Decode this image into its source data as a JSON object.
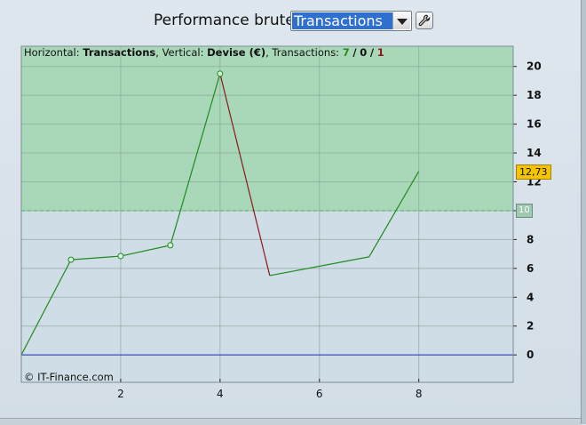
{
  "toolbar": {
    "label": "Performance brute",
    "selected_mode": "Transactions",
    "settings_icon": "wrench-icon"
  },
  "info": {
    "horizontal_label": "Horizontal:",
    "horizontal_value": "Transactions",
    "vertical_label": "Vertical:",
    "vertical_value": "Devise (€)",
    "transactions_label": "Transactions:",
    "wins": "7",
    "neutral": "0",
    "losses": "1",
    "sep1": ",",
    "sep2": ",",
    "slash": "/"
  },
  "copyright": "© IT-Finance.com",
  "badges": {
    "last_value": "12,73",
    "threshold": "10"
  },
  "colors": {
    "profit_zone": "#a9d8b8",
    "loss_zone": "#cfdde6",
    "up_line": "#1f8a1f",
    "down_line": "#8a1a1a",
    "zero_line": "#2233bb",
    "badge_last": "#f5c400"
  },
  "chart_data": {
    "type": "line",
    "x": [
      0,
      1,
      2,
      3,
      4,
      5,
      7,
      8
    ],
    "y": [
      0,
      6.6,
      6.85,
      7.6,
      19.5,
      5.5,
      6.8,
      12.73
    ],
    "markers_at_x": [
      1,
      2,
      3,
      4
    ],
    "x_ticks": [
      "2",
      "4",
      "6",
      "8"
    ],
    "x_tick_values": [
      2,
      4,
      6,
      8
    ],
    "y_ticks": [
      "0",
      "2",
      "4",
      "6",
      "8",
      "10",
      "12",
      "14",
      "16",
      "18",
      "20"
    ],
    "y_tick_values": [
      0,
      2,
      4,
      6,
      8,
      10,
      12,
      14,
      16,
      18,
      20
    ],
    "xlim": [
      0,
      9.9
    ],
    "ylim": [
      -1.9,
      21.4
    ],
    "threshold": 10,
    "grid": true
  }
}
